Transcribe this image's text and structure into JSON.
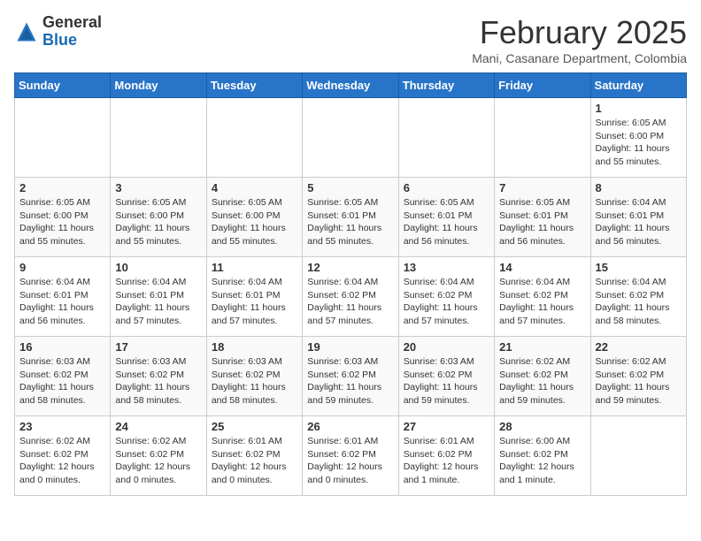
{
  "header": {
    "logo_general": "General",
    "logo_blue": "Blue",
    "month_title": "February 2025",
    "location": "Mani, Casanare Department, Colombia"
  },
  "weekdays": [
    "Sunday",
    "Monday",
    "Tuesday",
    "Wednesday",
    "Thursday",
    "Friday",
    "Saturday"
  ],
  "weeks": [
    [
      {
        "day": "",
        "info": ""
      },
      {
        "day": "",
        "info": ""
      },
      {
        "day": "",
        "info": ""
      },
      {
        "day": "",
        "info": ""
      },
      {
        "day": "",
        "info": ""
      },
      {
        "day": "",
        "info": ""
      },
      {
        "day": "1",
        "info": "Sunrise: 6:05 AM\nSunset: 6:00 PM\nDaylight: 11 hours and 55 minutes."
      }
    ],
    [
      {
        "day": "2",
        "info": "Sunrise: 6:05 AM\nSunset: 6:00 PM\nDaylight: 11 hours and 55 minutes."
      },
      {
        "day": "3",
        "info": "Sunrise: 6:05 AM\nSunset: 6:00 PM\nDaylight: 11 hours and 55 minutes."
      },
      {
        "day": "4",
        "info": "Sunrise: 6:05 AM\nSunset: 6:00 PM\nDaylight: 11 hours and 55 minutes."
      },
      {
        "day": "5",
        "info": "Sunrise: 6:05 AM\nSunset: 6:01 PM\nDaylight: 11 hours and 55 minutes."
      },
      {
        "day": "6",
        "info": "Sunrise: 6:05 AM\nSunset: 6:01 PM\nDaylight: 11 hours and 56 minutes."
      },
      {
        "day": "7",
        "info": "Sunrise: 6:05 AM\nSunset: 6:01 PM\nDaylight: 11 hours and 56 minutes."
      },
      {
        "day": "8",
        "info": "Sunrise: 6:04 AM\nSunset: 6:01 PM\nDaylight: 11 hours and 56 minutes."
      }
    ],
    [
      {
        "day": "9",
        "info": "Sunrise: 6:04 AM\nSunset: 6:01 PM\nDaylight: 11 hours and 56 minutes."
      },
      {
        "day": "10",
        "info": "Sunrise: 6:04 AM\nSunset: 6:01 PM\nDaylight: 11 hours and 57 minutes."
      },
      {
        "day": "11",
        "info": "Sunrise: 6:04 AM\nSunset: 6:01 PM\nDaylight: 11 hours and 57 minutes."
      },
      {
        "day": "12",
        "info": "Sunrise: 6:04 AM\nSunset: 6:02 PM\nDaylight: 11 hours and 57 minutes."
      },
      {
        "day": "13",
        "info": "Sunrise: 6:04 AM\nSunset: 6:02 PM\nDaylight: 11 hours and 57 minutes."
      },
      {
        "day": "14",
        "info": "Sunrise: 6:04 AM\nSunset: 6:02 PM\nDaylight: 11 hours and 57 minutes."
      },
      {
        "day": "15",
        "info": "Sunrise: 6:04 AM\nSunset: 6:02 PM\nDaylight: 11 hours and 58 minutes."
      }
    ],
    [
      {
        "day": "16",
        "info": "Sunrise: 6:03 AM\nSunset: 6:02 PM\nDaylight: 11 hours and 58 minutes."
      },
      {
        "day": "17",
        "info": "Sunrise: 6:03 AM\nSunset: 6:02 PM\nDaylight: 11 hours and 58 minutes."
      },
      {
        "day": "18",
        "info": "Sunrise: 6:03 AM\nSunset: 6:02 PM\nDaylight: 11 hours and 58 minutes."
      },
      {
        "day": "19",
        "info": "Sunrise: 6:03 AM\nSunset: 6:02 PM\nDaylight: 11 hours and 59 minutes."
      },
      {
        "day": "20",
        "info": "Sunrise: 6:03 AM\nSunset: 6:02 PM\nDaylight: 11 hours and 59 minutes."
      },
      {
        "day": "21",
        "info": "Sunrise: 6:02 AM\nSunset: 6:02 PM\nDaylight: 11 hours and 59 minutes."
      },
      {
        "day": "22",
        "info": "Sunrise: 6:02 AM\nSunset: 6:02 PM\nDaylight: 11 hours and 59 minutes."
      }
    ],
    [
      {
        "day": "23",
        "info": "Sunrise: 6:02 AM\nSunset: 6:02 PM\nDaylight: 12 hours and 0 minutes."
      },
      {
        "day": "24",
        "info": "Sunrise: 6:02 AM\nSunset: 6:02 PM\nDaylight: 12 hours and 0 minutes."
      },
      {
        "day": "25",
        "info": "Sunrise: 6:01 AM\nSunset: 6:02 PM\nDaylight: 12 hours and 0 minutes."
      },
      {
        "day": "26",
        "info": "Sunrise: 6:01 AM\nSunset: 6:02 PM\nDaylight: 12 hours and 0 minutes."
      },
      {
        "day": "27",
        "info": "Sunrise: 6:01 AM\nSunset: 6:02 PM\nDaylight: 12 hours and 1 minute."
      },
      {
        "day": "28",
        "info": "Sunrise: 6:00 AM\nSunset: 6:02 PM\nDaylight: 12 hours and 1 minute."
      },
      {
        "day": "",
        "info": ""
      }
    ]
  ]
}
